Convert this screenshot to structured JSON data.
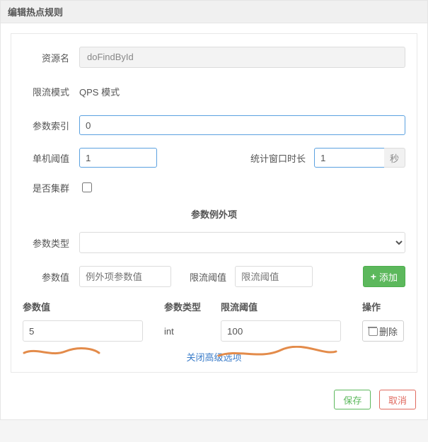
{
  "header": {
    "title": "编辑热点规则"
  },
  "form": {
    "resource_label": "资源名",
    "resource_value": "doFindById",
    "mode_label": "限流模式",
    "mode_value": "QPS 模式",
    "param_index_label": "参数索引",
    "param_index_value": "0",
    "threshold_label": "单机阈值",
    "threshold_value": "1",
    "window_label": "统计窗口时长",
    "window_value": "1",
    "window_unit": "秒",
    "cluster_label": "是否集群"
  },
  "exceptions": {
    "section_title": "参数例外项",
    "type_label": "参数类型",
    "param_val_label": "参数值",
    "param_val_placeholder": "例外项参数值",
    "limit_label": "限流阈值",
    "limit_placeholder": "限流阈值",
    "add_label": "添加",
    "columns": {
      "value": "参数值",
      "type": "参数类型",
      "limit": "限流阈值",
      "ops": "操作"
    },
    "rows": [
      {
        "value": "5",
        "type": "int",
        "limit": "100"
      }
    ],
    "delete_label": "删除"
  },
  "advanced_link": "关闭高级选项",
  "footer": {
    "save": "保存",
    "cancel": "取消"
  }
}
